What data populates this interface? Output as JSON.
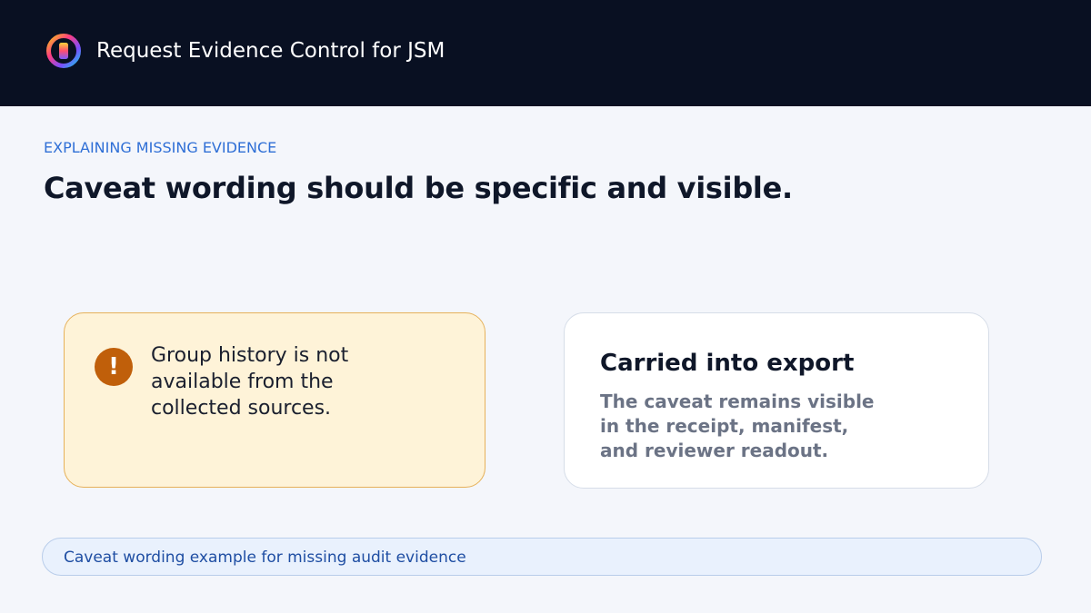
{
  "header": {
    "app_title": "Request Evidence Control for JSM",
    "logo_icon": "app-logo-icon"
  },
  "main": {
    "eyebrow": "EXPLAINING MISSING EVIDENCE",
    "headline": "Caveat wording should be specific and visible."
  },
  "warning_card": {
    "icon": "exclamation-icon",
    "icon_glyph": "!",
    "text": "Group history is not available from the collected sources."
  },
  "info_card": {
    "title": "Carried into export",
    "body": "The caveat remains visible in the receipt, manifest, and reviewer readout."
  },
  "caption": {
    "text": "Caveat wording example for missing audit evidence"
  },
  "colors": {
    "header_bg": "#091022",
    "accent_blue": "#2f6fd6",
    "warning_bg": "#fef3d8",
    "warning_border": "#e6b15a",
    "warning_icon": "#c05f0a"
  }
}
